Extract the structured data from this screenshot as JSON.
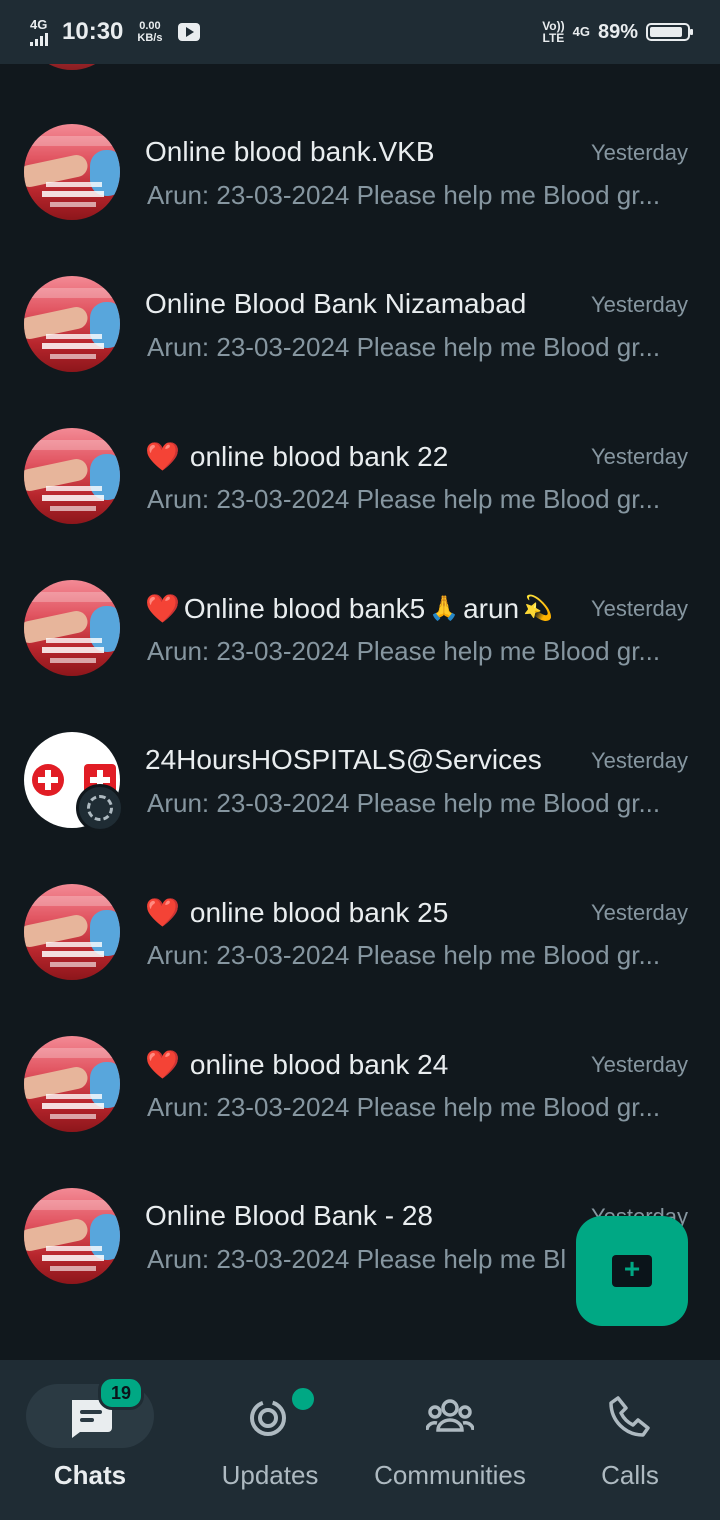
{
  "status_bar": {
    "network": "4G",
    "time": "10:30",
    "speed_value": "0.00",
    "speed_unit": "KB/s",
    "volte_top": "Vo))",
    "volte_bottom": "LTE",
    "network_right": "4G",
    "battery_percent": "89%",
    "battery_level": 0.89
  },
  "chats": [
    {
      "title": "Online blood bank.VKB",
      "time": "Yesterday",
      "sender": "Arun:",
      "preview": "23-03-2024 Please help me Blood gr...",
      "avatar": "blood-bank"
    },
    {
      "title": "Online Blood Bank Nizamabad",
      "time": "Yesterday",
      "sender": "Arun:",
      "preview": "23-03-2024 Please help me Blood gr...",
      "avatar": "blood-bank"
    },
    {
      "title": "online blood bank 22",
      "prefix": "❤️",
      "time": "Yesterday",
      "sender": "Arun:",
      "preview": "23-03-2024 Please help me Blood gr...",
      "avatar": "blood-bank"
    },
    {
      "title": "Online blood bank5",
      "prefix": "❤️",
      "suffix_emoji": "🙏",
      "suffix_text": "arun",
      "suffix_emoji2": "💫",
      "time": "Yesterday",
      "sender": "Arun:",
      "preview": "23-03-2024 Please help me Blood gr...",
      "avatar": "blood-bank"
    },
    {
      "title": "24HoursHOSPITALS@Services",
      "time": "Yesterday",
      "sender": "Arun:",
      "preview": "23-03-2024 Please help me Blood gr...",
      "avatar": "hospital"
    },
    {
      "title": "online blood bank 25",
      "prefix": "❤️",
      "time": "Yesterday",
      "sender": "Arun:",
      "preview": "23-03-2024 Please help me Blood gr...",
      "avatar": "blood-bank"
    },
    {
      "title": "online blood bank 24",
      "prefix": "❤️",
      "time": "Yesterday",
      "sender": "Arun:",
      "preview": "23-03-2024 Please help me Blood gr...",
      "avatar": "blood-bank"
    },
    {
      "title": "Online Blood Bank - 28",
      "time": "Yesterday",
      "sender": "Arun:",
      "preview": "23-03-2024 Please help me Bl",
      "avatar": "blood-bank"
    }
  ],
  "fab": {
    "icon": "new-chat-icon"
  },
  "nav": {
    "chats": {
      "label": "Chats",
      "badge": "19",
      "icon": "chat-icon"
    },
    "updates": {
      "label": "Updates",
      "icon": "status-icon"
    },
    "communities": {
      "label": "Communities",
      "icon": "communities-icon"
    },
    "calls": {
      "label": "Calls",
      "icon": "phone-icon"
    }
  },
  "colors": {
    "accent": "#00a884",
    "background": "#11181d",
    "bar": "#1f2c34",
    "text_primary": "#e9edef",
    "text_secondary": "#8696a0"
  }
}
